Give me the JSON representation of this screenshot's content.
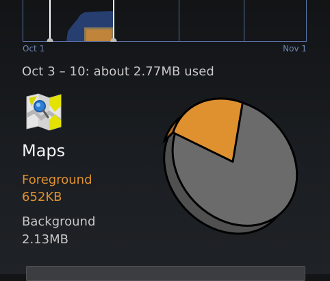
{
  "chart": {
    "axis_start": "Oct 1",
    "axis_end": "Nov 1"
  },
  "usage": {
    "summary": "Oct 3 – 10: about 2.77MB used"
  },
  "app": {
    "name": "Maps",
    "icon": "maps-icon",
    "foreground_label": "Foreground",
    "foreground_value": "652KB",
    "background_label": "Background",
    "background_value": "2.13MB",
    "foreground_fraction": 0.23
  },
  "colors": {
    "foreground": "#e0912f",
    "background_slice": "#6b6b6b",
    "axis_text": "#6f87b4",
    "grid_lines": "#5b72a6"
  }
}
